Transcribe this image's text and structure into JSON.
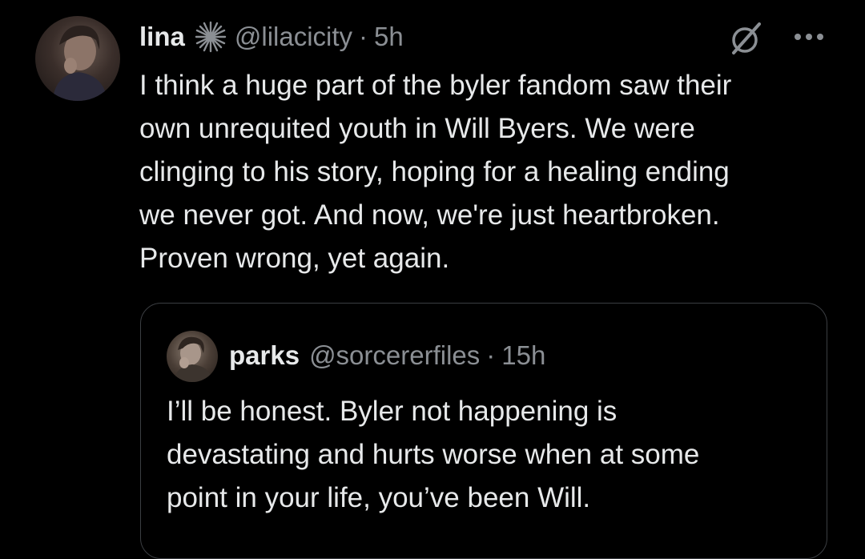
{
  "tweet": {
    "author": {
      "display_name": "lina",
      "badge_icon": "sparkle-icon",
      "handle": "@lilacicity",
      "separator": "·",
      "time": "5h"
    },
    "header_actions": {
      "grok_icon": "grok-icon",
      "more_icon": "more-icon"
    },
    "body_lines": [
      "I think a huge part of the byler fandom saw their",
      "own unrequited youth in Will Byers. We were",
      "clinging to his story, hoping for a healing ending",
      "we never got. And now, we're just heartbroken.",
      "Proven wrong, yet again."
    ],
    "quoted": {
      "display_name": "parks",
      "handle": "@sorcererfiles",
      "separator": "·",
      "time": "15h",
      "body_lines": [
        "I’ll be honest. Byler not happening is",
        "devastating and hurts worse when at some",
        "point in your life, you’ve been Will."
      ]
    }
  },
  "colors": {
    "background": "#000000",
    "primary_text": "#e7e9ea",
    "secondary_text": "#8b8f94",
    "border": "#3b3e42"
  }
}
